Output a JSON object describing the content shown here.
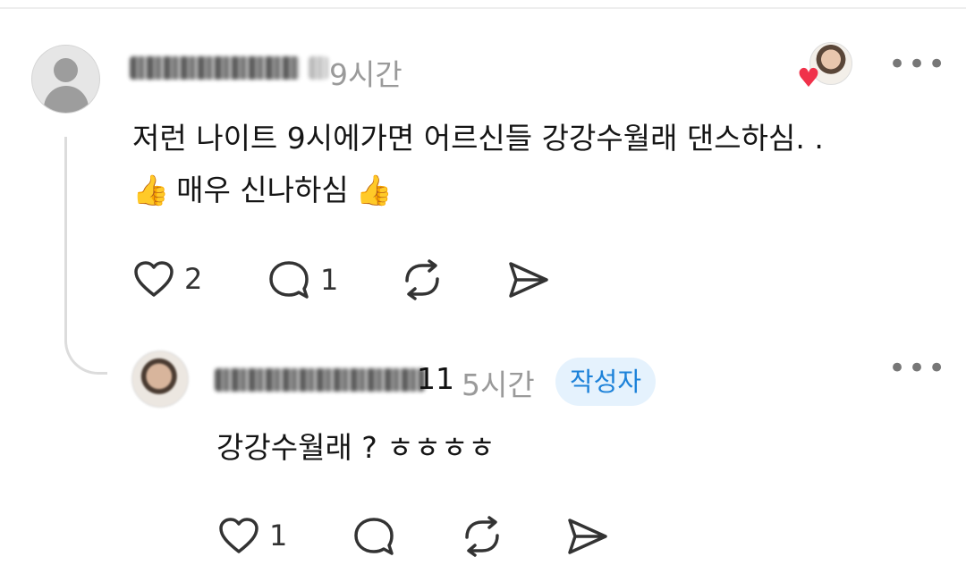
{
  "comment": {
    "username": "",
    "time": "9시간",
    "more_label": "•••",
    "text_line1": "저런 나이트 9시에가면 어르신들 강강수월래 댄스하심. .",
    "text_line2": "매우 신나하심",
    "emoji": "👍",
    "likes": "2",
    "replies": "1",
    "liked_by_author": true
  },
  "reply": {
    "username_suffix": "11",
    "time": "5시간",
    "author_badge": "작성자",
    "more_label": "•••",
    "text": "강강수월래 ? ㅎㅎㅎㅎ",
    "likes": "1"
  },
  "icons": {
    "like": "heart-icon",
    "reply": "speech-bubble-icon",
    "repost": "repost-icon",
    "share": "send-icon",
    "more": "more-dots-icon"
  },
  "colors": {
    "badge_bg": "#e5f2fd",
    "badge_text": "#1d82d9",
    "like_heart": "#f0314a"
  }
}
